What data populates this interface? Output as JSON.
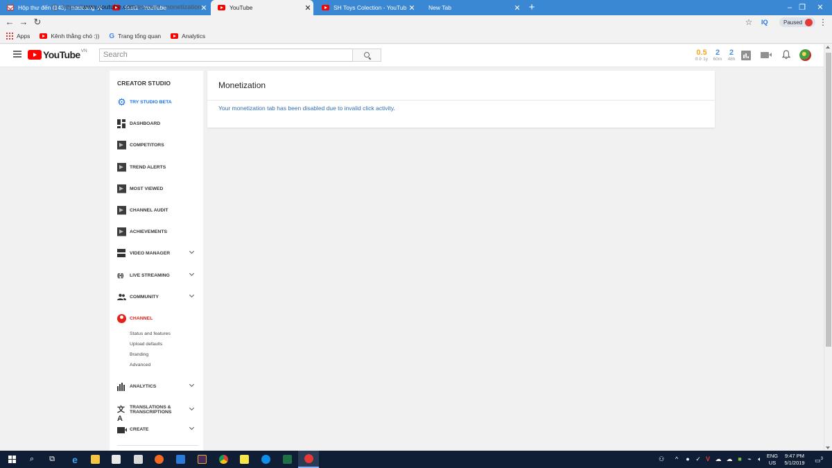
{
  "browser": {
    "tabs": [
      {
        "title": "Hộp thư đến (143) - haotrang12...",
        "favicon": "gmail-icon",
        "active": false
      },
      {
        "title": "Test1 - YouTube",
        "favicon": "youtube-icon",
        "active": false
      },
      {
        "title": "YouTube",
        "favicon": "youtube-icon",
        "active": true
      },
      {
        "title": "SH Toys Colection - YouTube",
        "favicon": "youtube-icon",
        "active": false
      },
      {
        "title": "New Tab",
        "favicon": "",
        "active": false
      }
    ],
    "new_tab_symbol": "+",
    "window_controls": {
      "minimize": "–",
      "restore": "❐",
      "close": "✕"
    },
    "url_scheme": "https://",
    "url_host": "www.youtube.com",
    "url_path": "/account_monetization",
    "extension_label": "IQ",
    "profile_chip": "Paused",
    "bookmarks": [
      {
        "label": "Apps",
        "icon": "apps-grid-icon"
      },
      {
        "label": "Kênh thằng chó :))",
        "icon": "youtube-icon"
      },
      {
        "label": "Trang tổng quan",
        "icon": "google-icon"
      },
      {
        "label": "Analytics",
        "icon": "youtube-icon"
      }
    ]
  },
  "youtube": {
    "logo_text": "YouTube",
    "logo_country": "VN",
    "search_placeholder": "Search",
    "stats": [
      {
        "value": "0.5",
        "label": "tỉ ở 1y",
        "color": "#f5a623"
      },
      {
        "value": "2",
        "label": "60m",
        "color": "#4a90d9"
      },
      {
        "value": "2",
        "label": "48h",
        "color": "#4a90d9"
      }
    ]
  },
  "sidebar": {
    "title": "CREATOR STUDIO",
    "items": [
      {
        "label": "TRY STUDIO BETA",
        "icon": "gear-icon",
        "highlight": "#1a73e8"
      },
      {
        "label": "DASHBOARD",
        "icon": "dashboard-icon"
      },
      {
        "label": "COMPETITORS",
        "icon": "extension-icon"
      },
      {
        "label": "TREND ALERTS",
        "icon": "extension-icon"
      },
      {
        "label": "MOST VIEWED",
        "icon": "extension-icon"
      },
      {
        "label": "CHANNEL AUDIT",
        "icon": "extension-icon"
      },
      {
        "label": "ACHIEVEMENTS",
        "icon": "extension-icon"
      },
      {
        "label": "VIDEO MANAGER",
        "icon": "video-manager-icon",
        "expandable": true
      },
      {
        "label": "LIVE STREAMING",
        "icon": "live-icon",
        "expandable": true
      },
      {
        "label": "COMMUNITY",
        "icon": "community-icon",
        "expandable": true
      },
      {
        "label": "CHANNEL",
        "icon": "channel-icon",
        "highlight": "#e62117"
      },
      {
        "label": "ANALYTICS",
        "icon": "analytics-icon",
        "expandable": true
      },
      {
        "label": "TRANSLATIONS & TRANSCRIPTIONS",
        "icon": "translate-icon",
        "expandable": true
      },
      {
        "label": "CREATE",
        "icon": "create-icon",
        "expandable": true
      }
    ],
    "channel_subitems": [
      "Status and features",
      "Upload defaults",
      "Branding",
      "Advanced"
    ]
  },
  "main": {
    "title": "Monetization",
    "notice": "Your monetization tab has been disabled due to invalid click activity."
  },
  "taskbar": {
    "language": "ENG",
    "region": "US",
    "time": "9:47 PM",
    "date": "5/1/2019",
    "notification_count": "3"
  }
}
